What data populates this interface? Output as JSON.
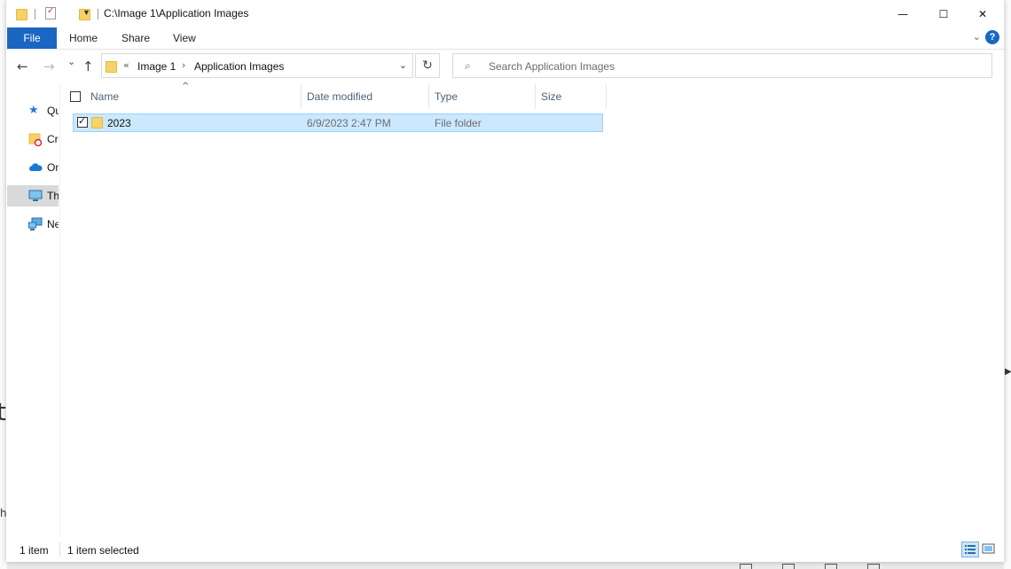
{
  "window": {
    "title": "C:\\Image 1\\Application Images",
    "minimize_glyph": "—",
    "maximize_glyph": "☐",
    "close_glyph": "✕"
  },
  "ribbon": {
    "tabs": [
      {
        "label": "File"
      },
      {
        "label": "Home"
      },
      {
        "label": "Share"
      },
      {
        "label": "View"
      }
    ],
    "help_glyph": "?"
  },
  "nav": {
    "back_glyph": "←",
    "forward_glyph": "→",
    "recent_glyph": "⌄",
    "up_glyph": "↑",
    "address": {
      "overflow_glyph": "«",
      "crumbs": [
        "Image 1",
        "Application Images"
      ],
      "separator_glyph": "›",
      "dropdown_glyph": "⌄"
    },
    "refresh_glyph": "↻",
    "search": {
      "placeholder": "Search Application Images",
      "value": ""
    }
  },
  "navpane": {
    "items": [
      {
        "label": "Quick access",
        "icon": "star-icon"
      },
      {
        "label": "Creative Cloud Files",
        "icon": "creative-cloud-icon"
      },
      {
        "label": "OneDrive",
        "icon": "onedrive-icon"
      },
      {
        "label": "This PC",
        "icon": "this-pc-icon",
        "selected": true
      },
      {
        "label": "Network",
        "icon": "network-icon"
      }
    ]
  },
  "columns": {
    "name": "Name",
    "date": "Date modified",
    "type": "Type",
    "size": "Size",
    "sort_glyph": "^"
  },
  "files": [
    {
      "name": "2023",
      "date": "6/9/2023 2:47 PM",
      "type": "File folder",
      "size": "",
      "selected": true,
      "checked": true
    }
  ],
  "status": {
    "count": "1 item",
    "selection": "1 item selected"
  },
  "colors": {
    "accent": "#1a67c2",
    "selection_bg": "#cce8ff",
    "selection_border": "#99d1ff",
    "folder": "#f5d36b",
    "header_text": "#4c607a"
  }
}
